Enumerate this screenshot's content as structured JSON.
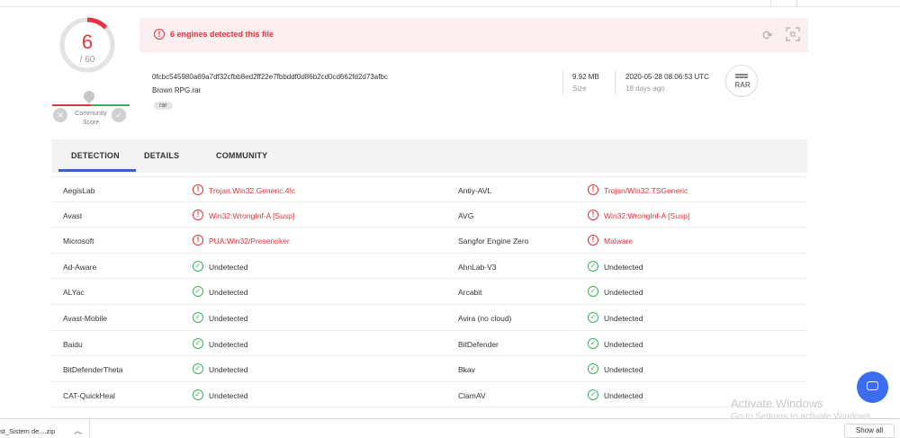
{
  "score": {
    "positives": "6",
    "total": "/ 60"
  },
  "community": {
    "label_line1": "Community",
    "label_line2": "Score"
  },
  "banner": {
    "message": "6 engines detected this file"
  },
  "file": {
    "hash": "0fcbc545980a69a7df32cfbb8ed2ff22e7fbbddf0d86b2cd0cd662fd2d73afbc",
    "name": "Brown RPG.rar",
    "tag": "rar",
    "size_value": "9.92 MB",
    "size_label": "Size",
    "date_value": "2020-05-28 08:06:53 UTC",
    "date_label": "18 days ago",
    "type_label": "RAR"
  },
  "tabs": [
    {
      "label": "DETECTION",
      "active": true
    },
    {
      "label": "DETAILS",
      "active": false
    },
    {
      "label": "COMMUNITY",
      "active": false
    }
  ],
  "detections": [
    {
      "left_engine": "AegisLab",
      "left_result": "Trojan.Win32.Generic.4!c",
      "left_status": "bad",
      "right_engine": "Antiy-AVL",
      "right_result": "Trojan/Win32.TSGeneric",
      "right_status": "bad"
    },
    {
      "left_engine": "Avast",
      "left_result": "Win32:WrongInf-A [Susp]",
      "left_status": "bad",
      "right_engine": "AVG",
      "right_result": "Win32:WrongInf-A [Susp]",
      "right_status": "bad"
    },
    {
      "left_engine": "Microsoft",
      "left_result": "PUA:Win32/Presenoker",
      "left_status": "bad",
      "right_engine": "Sangfor Engine Zero",
      "right_result": "Malware",
      "right_status": "bad"
    },
    {
      "left_engine": "Ad-Aware",
      "left_result": "Undetected",
      "left_status": "good",
      "right_engine": "AhnLab-V3",
      "right_result": "Undetected",
      "right_status": "good"
    },
    {
      "left_engine": "ALYac",
      "left_result": "Undetected",
      "left_status": "good",
      "right_engine": "Arcabit",
      "right_result": "Undetected",
      "right_status": "good"
    },
    {
      "left_engine": "Avast-Mobile",
      "left_result": "Undetected",
      "left_status": "good",
      "right_engine": "Avira (no cloud)",
      "right_result": "Undetected",
      "right_status": "good"
    },
    {
      "left_engine": "Baidu",
      "left_result": "Undetected",
      "left_status": "good",
      "right_engine": "BitDefender",
      "right_result": "Undetected",
      "right_status": "good"
    },
    {
      "left_engine": "BitDefenderTheta",
      "left_result": "Undetected",
      "left_status": "good",
      "right_engine": "Bkav",
      "right_result": "Undetected",
      "right_status": "good"
    },
    {
      "left_engine": "CAT-QuickHeal",
      "left_result": "Undetected",
      "left_status": "good",
      "right_engine": "ClamAV",
      "right_result": "Undetected",
      "right_status": "good"
    }
  ],
  "watermark": {
    "line1": "Activate Windows",
    "line2": "Go to Settings to activate Windows."
  },
  "download_bar": {
    "file_name": "st_Sistem de....zip",
    "show_all": "Show all"
  },
  "colors": {
    "danger": "#e0363d",
    "safe": "#3bb15d",
    "accent": "#3b61c9",
    "chat": "#3b6df0"
  },
  "icons": {
    "warning": "exclamation-circle-icon",
    "ok": "check-circle-icon",
    "reload": "reload-icon",
    "expand": "expand-icon",
    "chat": "chat-icon",
    "chevron": "chevron-up-icon"
  }
}
